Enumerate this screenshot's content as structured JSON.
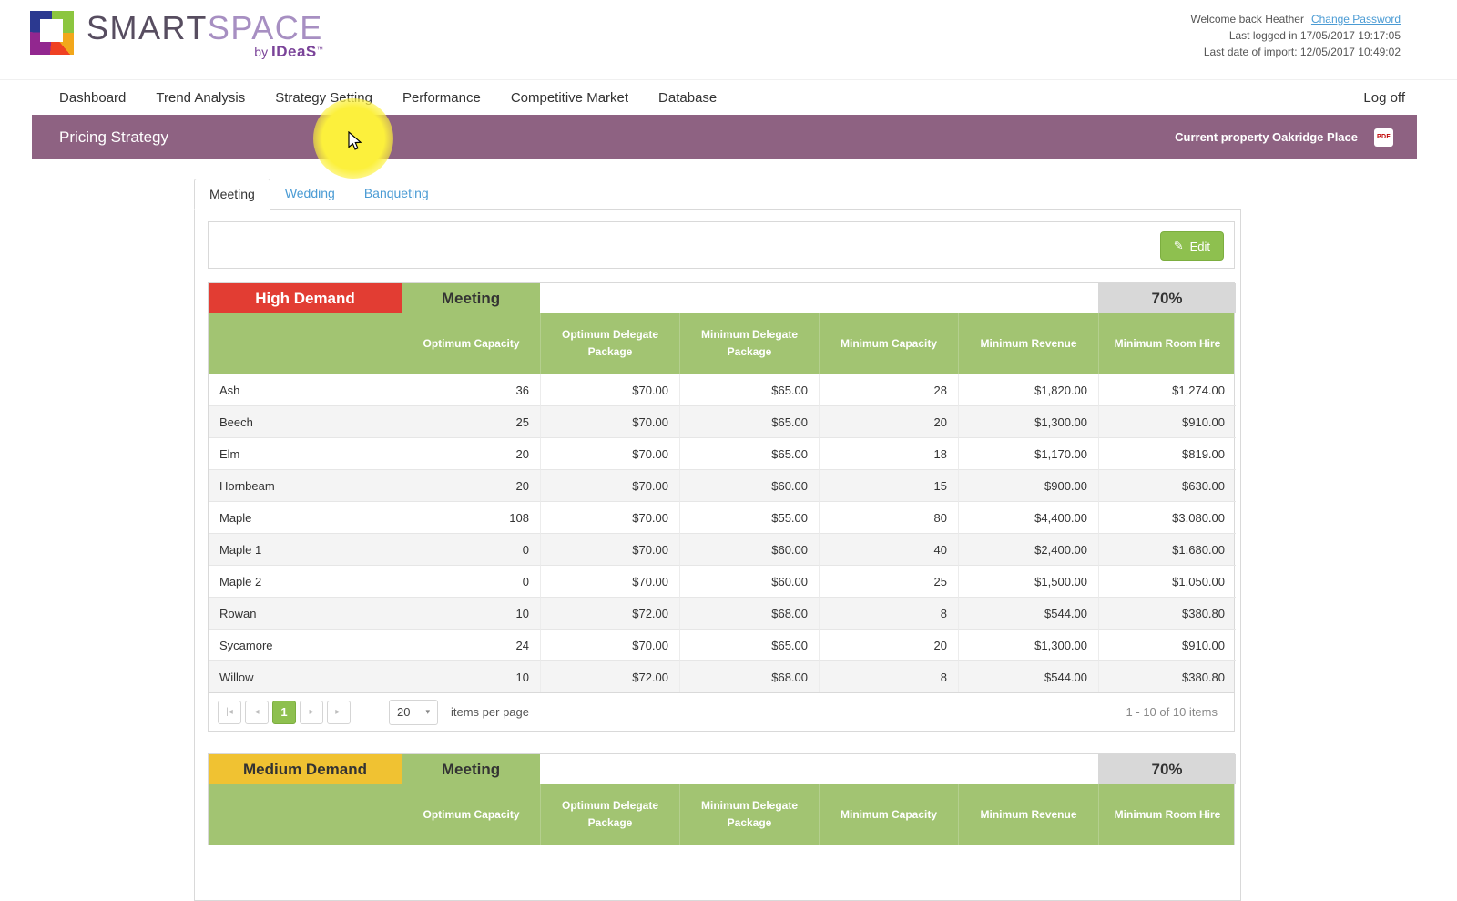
{
  "colors": {
    "banner_bg": "#8e6282",
    "table_header_green": "#a2c472",
    "percent_gray": "#d8d8d8",
    "accent_green": "#8ec04f",
    "link_blue": "#4a9bd4",
    "highlight_yellow": "#fcf03c"
  },
  "header": {
    "logo": {
      "smart": "SMART",
      "space": "SPACE",
      "by": "by",
      "ideas": "IDeaS",
      "tm": "™"
    },
    "welcome": "Welcome back Heather",
    "change_password": "Change Password",
    "last_logged_in": "Last logged in 17/05/2017 19:17:05",
    "last_import": "Last date of import: 12/05/2017 10:49:02"
  },
  "nav": {
    "items": [
      "Dashboard",
      "Trend Analysis",
      "Strategy Setting",
      "Performance",
      "Competitive Market",
      "Database"
    ],
    "logoff": "Log off"
  },
  "banner": {
    "title": "Pricing Strategy",
    "current_property": "Current property Oakridge Place"
  },
  "tabs": [
    "Meeting",
    "Wedding",
    "Banqueting"
  ],
  "toolbar": {
    "edit_label": "Edit"
  },
  "icons": {
    "pencil": "✎",
    "caret_down": "▾",
    "pager_first": "|◂",
    "pager_prev": "◂",
    "pager_next": "▸",
    "pager_last": "▸|",
    "pdf_label": "PDF"
  },
  "demand_tables": [
    {
      "demand_label": "High Demand",
      "demand_color": "#e23d33",
      "demand_text_color": "#ffffff",
      "segment": "Meeting",
      "percent": "70%",
      "columns": [
        "Optimum Capacity",
        "Optimum Delegate Package",
        "Minimum Delegate Package",
        "Minimum Capacity",
        "Minimum Revenue",
        "Minimum Room Hire"
      ],
      "rows": [
        [
          "Ash",
          "36",
          "$70.00",
          "$65.00",
          "28",
          "$1,820.00",
          "$1,274.00"
        ],
        [
          "Beech",
          "25",
          "$70.00",
          "$65.00",
          "20",
          "$1,300.00",
          "$910.00"
        ],
        [
          "Elm",
          "20",
          "$70.00",
          "$65.00",
          "18",
          "$1,170.00",
          "$819.00"
        ],
        [
          "Hornbeam",
          "20",
          "$70.00",
          "$60.00",
          "15",
          "$900.00",
          "$630.00"
        ],
        [
          "Maple",
          "108",
          "$70.00",
          "$55.00",
          "80",
          "$4,400.00",
          "$3,080.00"
        ],
        [
          "Maple 1",
          "0",
          "$70.00",
          "$60.00",
          "40",
          "$2,400.00",
          "$1,680.00"
        ],
        [
          "Maple 2",
          "0",
          "$70.00",
          "$60.00",
          "25",
          "$1,500.00",
          "$1,050.00"
        ],
        [
          "Rowan",
          "10",
          "$72.00",
          "$68.00",
          "8",
          "$544.00",
          "$380.80"
        ],
        [
          "Sycamore",
          "24",
          "$70.00",
          "$65.00",
          "20",
          "$1,300.00",
          "$910.00"
        ],
        [
          "Willow",
          "10",
          "$72.00",
          "$68.00",
          "8",
          "$544.00",
          "$380.80"
        ]
      ],
      "pager": {
        "page": "1",
        "page_size": "20",
        "items_label": "items per page",
        "range": "1 - 10 of 10 items"
      }
    },
    {
      "demand_label": "Medium Demand",
      "demand_color": "#f0c232",
      "demand_text_color": "#333333",
      "segment": "Meeting",
      "percent": "70%",
      "columns": [
        "Optimum Capacity",
        "Optimum Delegate Package",
        "Minimum Delegate Package",
        "Minimum Capacity",
        "Minimum Revenue",
        "Minimum Room Hire"
      ],
      "rows": []
    }
  ]
}
